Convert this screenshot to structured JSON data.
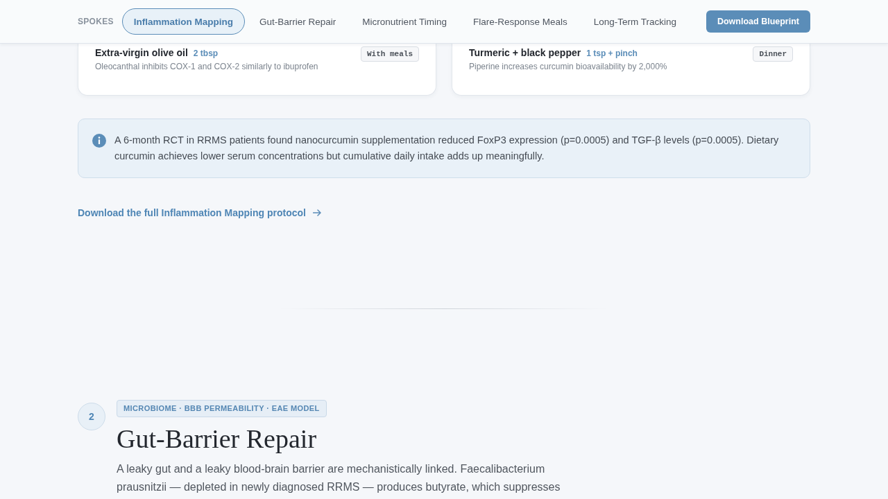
{
  "nav": {
    "label": "SPOKES",
    "tabs": [
      {
        "label": "Inflammation Mapping",
        "selected": true
      },
      {
        "label": "Gut-Barrier Repair",
        "selected": false
      },
      {
        "label": "Micronutrient Timing",
        "selected": false
      },
      {
        "label": "Flare-Response Meals",
        "selected": false
      },
      {
        "label": "Long-Term Tracking",
        "selected": false
      }
    ],
    "button": "Download Blueprint"
  },
  "foods": [
    {
      "name": "Extra-virgin olive oil",
      "dose": "2 tbsp",
      "note": "Oleocanthal inhibits COX-1 and COX-2 similarly to ibuprofen",
      "timing": "With meals"
    },
    {
      "name": "Turmeric + black pepper",
      "dose": "1 tsp + pinch",
      "note": "Piperine increases curcumin bioavailability by 2,000%",
      "timing": "Dinner"
    }
  ],
  "callout": {
    "text": "A 6-month RCT in RRMS patients found nanocurcumin supplementation reduced FoxP3 expression (p=0.0005) and TGF-β levels (p=0.0005). Dietary curcumin achieves lower serum concentrations but cumulative daily intake adds up meaningfully."
  },
  "link": {
    "label": "Download the full Inflammation Mapping protocol"
  },
  "section": {
    "number": "2",
    "tags": "MICROBIOME · BBB PERMEABILITY · EAE MODEL",
    "title": "Gut-Barrier Repair",
    "body": "A leaky gut and a leaky blood-brain barrier are mechanistically linked. Faecalibacterium prausnitzii — depleted in newly diagnosed RRMS — produces butyrate, which suppresses"
  }
}
